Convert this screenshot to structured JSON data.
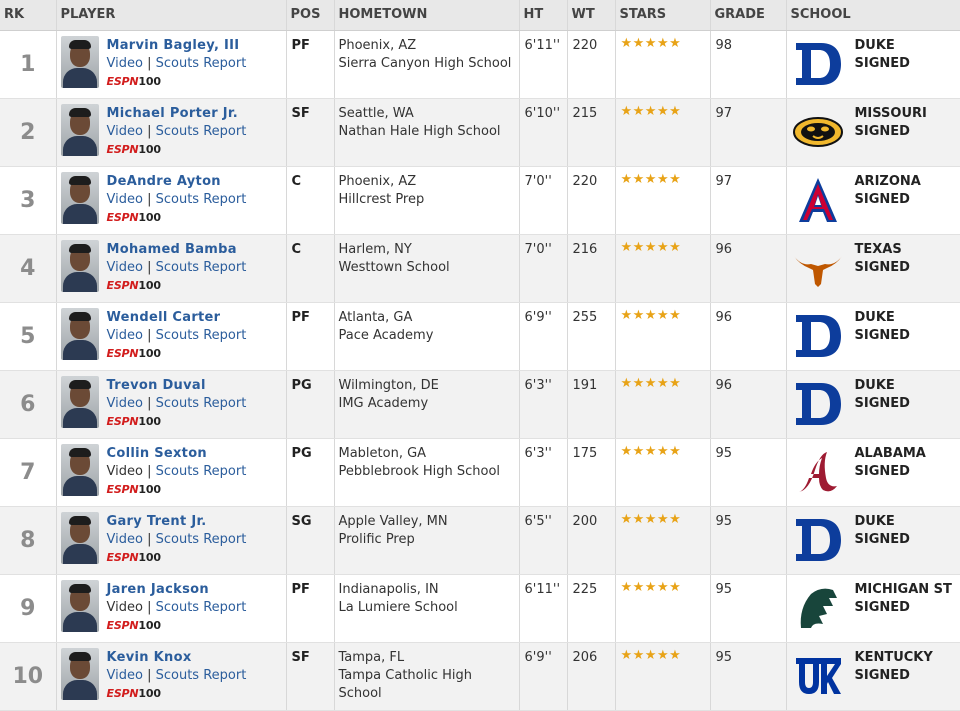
{
  "table": {
    "columns": {
      "rk": "RK",
      "player": "PLAYER",
      "pos": "POS",
      "hometown": "HOMETOWN",
      "ht": "HT",
      "wt": "WT",
      "stars": "STARS",
      "grade": "GRADE",
      "school": "SCHOOL"
    },
    "links": {
      "video": "Video",
      "separator": "|",
      "scouts": "Scouts Report"
    },
    "badge": {
      "espn": "ESPN",
      "hundred": "100"
    },
    "rows": [
      {
        "rank": "1",
        "name": "Marvin Bagley, III",
        "pos": "PF",
        "city": "Phoenix, AZ",
        "school_hs": "Sierra Canyon High School",
        "ht": "6'11''",
        "wt": "220",
        "stars": "★★★★★",
        "grade": "98",
        "college": "DUKE",
        "status": "SIGNED",
        "logo": "duke-logo",
        "video_link": true
      },
      {
        "rank": "2",
        "name": "Michael Porter Jr.",
        "pos": "SF",
        "city": "Seattle, WA",
        "school_hs": "Nathan Hale High School",
        "ht": "6'10''",
        "wt": "215",
        "stars": "★★★★★",
        "grade": "97",
        "college": "MISSOURI",
        "status": "SIGNED",
        "logo": "missouri-logo",
        "video_link": true
      },
      {
        "rank": "3",
        "name": "DeAndre Ayton",
        "pos": "C",
        "city": "Phoenix, AZ",
        "school_hs": "Hillcrest Prep",
        "ht": "7'0''",
        "wt": "220",
        "stars": "★★★★★",
        "grade": "97",
        "college": "ARIZONA",
        "status": "SIGNED",
        "logo": "arizona-logo",
        "video_link": true
      },
      {
        "rank": "4",
        "name": "Mohamed Bamba",
        "pos": "C",
        "city": "Harlem, NY",
        "school_hs": "Westtown School",
        "ht": "7'0''",
        "wt": "216",
        "stars": "★★★★★",
        "grade": "96",
        "college": "TEXAS",
        "status": "SIGNED",
        "logo": "texas-logo",
        "video_link": true
      },
      {
        "rank": "5",
        "name": "Wendell Carter",
        "pos": "PF",
        "city": "Atlanta, GA",
        "school_hs": "Pace Academy",
        "ht": "6'9''",
        "wt": "255",
        "stars": "★★★★★",
        "grade": "96",
        "college": "DUKE",
        "status": "SIGNED",
        "logo": "duke-logo",
        "video_link": true
      },
      {
        "rank": "6",
        "name": "Trevon Duval",
        "pos": "PG",
        "city": "Wilmington, DE",
        "school_hs": "IMG Academy",
        "ht": "6'3''",
        "wt": "191",
        "stars": "★★★★★",
        "grade": "96",
        "college": "DUKE",
        "status": "SIGNED",
        "logo": "duke-logo",
        "video_link": true
      },
      {
        "rank": "7",
        "name": "Collin Sexton",
        "pos": "PG",
        "city": "Mableton, GA",
        "school_hs": "Pebblebrook High School",
        "ht": "6'3''",
        "wt": "175",
        "stars": "★★★★★",
        "grade": "95",
        "college": "ALABAMA",
        "status": "SIGNED",
        "logo": "alabama-logo",
        "video_link": false
      },
      {
        "rank": "8",
        "name": "Gary Trent Jr.",
        "pos": "SG",
        "city": "Apple Valley, MN",
        "school_hs": "Prolific Prep",
        "ht": "6'5''",
        "wt": "200",
        "stars": "★★★★★",
        "grade": "95",
        "college": "DUKE",
        "status": "SIGNED",
        "logo": "duke-logo",
        "video_link": true
      },
      {
        "rank": "9",
        "name": "Jaren Jackson",
        "pos": "PF",
        "city": "Indianapolis, IN",
        "school_hs": "La Lumiere School",
        "ht": "6'11''",
        "wt": "225",
        "stars": "★★★★★",
        "grade": "95",
        "college": "MICHIGAN ST",
        "status": "SIGNED",
        "logo": "michigan-state-logo",
        "video_link": false
      },
      {
        "rank": "10",
        "name": "Kevin Knox",
        "pos": "SF",
        "city": "Tampa, FL",
        "school_hs": "Tampa Catholic High School",
        "ht": "6'9''",
        "wt": "206",
        "stars": "★★★★★",
        "grade": "95",
        "college": "KENTUCKY",
        "status": "SIGNED",
        "logo": "kentucky-logo",
        "video_link": true
      }
    ]
  },
  "colors": {
    "link": "#2b5d9c",
    "star": "#e8a317",
    "espn_red": "#d21d1d",
    "duke": "#0d3d9c",
    "missouri": "#f1b82d",
    "arizona": "#cc0033",
    "texas": "#bf5700",
    "alabama": "#9e1b32",
    "michigan_state": "#18453b",
    "kentucky": "#0033a0"
  }
}
